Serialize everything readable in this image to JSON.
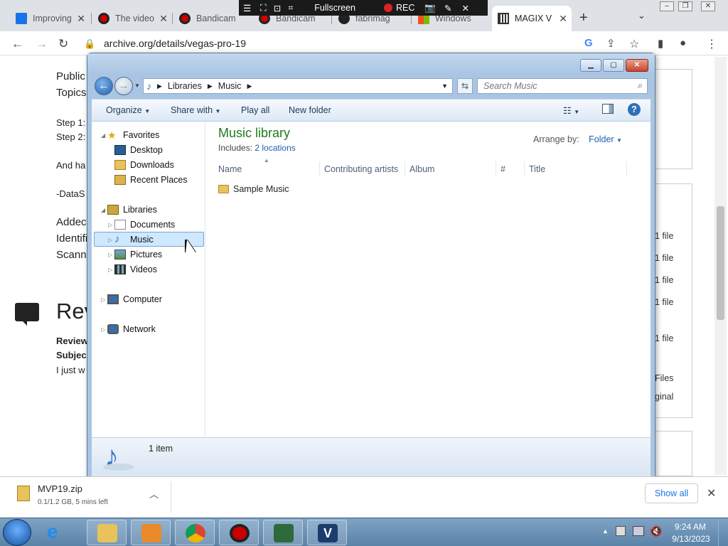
{
  "browser": {
    "tabs": [
      {
        "title": "Improving"
      },
      {
        "title": "The video"
      },
      {
        "title": "Bandicam"
      },
      {
        "title": "Bandicam"
      },
      {
        "title": "fabrimag"
      },
      {
        "title": "Windows"
      },
      {
        "title": "MAGIX V"
      }
    ],
    "url": "archive.org/details/vegas-pro-19"
  },
  "bandicam": {
    "mode": "Fullscreen",
    "rec_label": "REC"
  },
  "webpage": {
    "lines": [
      {
        "text": "Public"
      },
      {
        "text": "Topics"
      },
      {
        "text": "Step 1:"
      },
      {
        "text": "Step 2:"
      },
      {
        "text": "And ha"
      },
      {
        "text": "-DataS"
      },
      {
        "text": "Addec"
      },
      {
        "text": "Identifi"
      },
      {
        "text": "Scann"
      }
    ],
    "reviews_heading": "Rev",
    "review_lines": [
      {
        "text": "Review"
      },
      {
        "text": "Subjec"
      },
      {
        "text": "I just w"
      }
    ],
    "file_items": [
      {
        "text": "1 file"
      },
      {
        "text": "1 file"
      },
      {
        "text": "1 file"
      },
      {
        "text": "1 file"
      },
      {
        "text": "1 file"
      },
      {
        "text": "Files"
      },
      {
        "text": "ginal"
      }
    ]
  },
  "explorer": {
    "breadcrumb": [
      "Libraries",
      "Music"
    ],
    "search_placeholder": "Search Music",
    "toolbar": {
      "organize": "Organize",
      "share_with": "Share with",
      "play_all": "Play all",
      "new_folder": "New folder"
    },
    "nav": {
      "favorites": "Favorites",
      "desktop": "Desktop",
      "downloads": "Downloads",
      "recent_places": "Recent Places",
      "libraries": "Libraries",
      "documents": "Documents",
      "music": "Music",
      "pictures": "Pictures",
      "videos": "Videos",
      "computer": "Computer",
      "network": "Network"
    },
    "library_title": "Music library",
    "includes_label": "Includes:",
    "locations_link": "2 locations",
    "arrange_by_label": "Arrange by:",
    "arrange_by_value": "Folder",
    "columns": [
      "Name",
      "Contributing artists",
      "Album",
      "#",
      "Title"
    ],
    "items": [
      {
        "name": "Sample Music"
      }
    ],
    "status": "1 item"
  },
  "downloads_bar": {
    "file_name": "MVP19.zip",
    "file_status": "0.1/1.2 GB, 5 mins left",
    "show_all": "Show all"
  },
  "taskbar": {
    "time": "9:24 AM",
    "date": "9/13/2023"
  },
  "colors": {
    "library_title": "#1e7a1e",
    "link": "#1f5fb0",
    "selection": "#cde8ff"
  }
}
